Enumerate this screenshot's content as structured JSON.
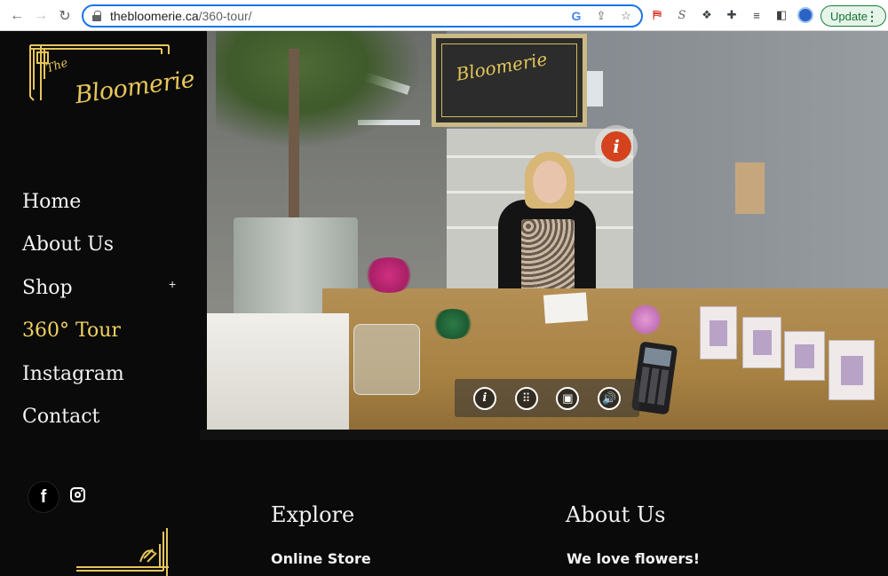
{
  "browser": {
    "url_host": "thebloomerie.ca",
    "url_path": "/360-tour/",
    "update_label": "Update"
  },
  "site": {
    "logo_small": "The",
    "logo_main": "Bloomerie",
    "accent_color": "#f0d260"
  },
  "nav": {
    "items": [
      {
        "label": "Home"
      },
      {
        "label": "About Us"
      },
      {
        "label": "Shop"
      },
      {
        "label": "360° Tour"
      },
      {
        "label": "Instagram"
      },
      {
        "label": "Contact"
      }
    ],
    "shop_expand": "+"
  },
  "tour": {
    "sign_text": "Bloomerie",
    "hotspot_label": "i",
    "controls": [
      {
        "icon": "info-icon",
        "glyph": "i"
      },
      {
        "icon": "grid-icon",
        "glyph": "⠿"
      },
      {
        "icon": "fullscreen-icon",
        "glyph": "▣"
      },
      {
        "icon": "volume-icon",
        "glyph": "🔊"
      }
    ]
  },
  "footer": {
    "facebook_glyph": "f",
    "explore_title": "Explore",
    "explore_link": "Online Store",
    "about_title": "About Us",
    "about_text": "We love flowers!"
  }
}
